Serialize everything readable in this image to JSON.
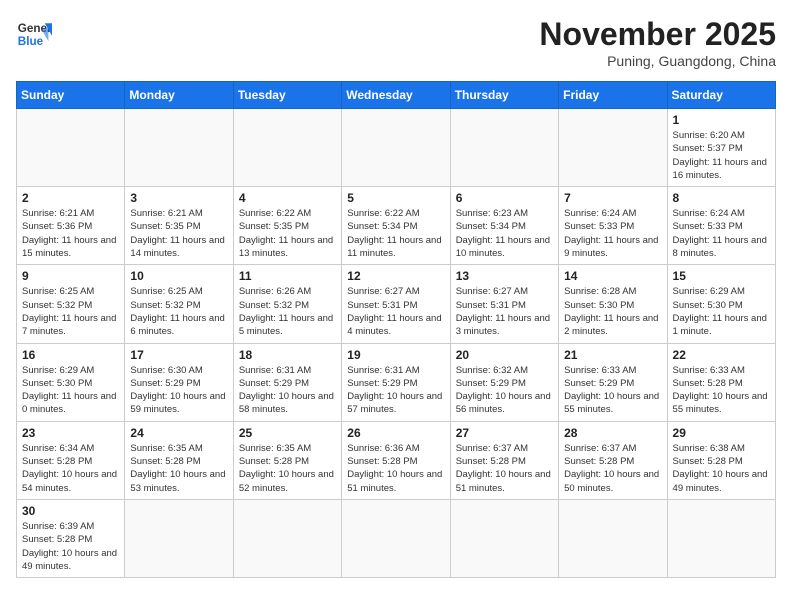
{
  "logo": {
    "line1": "General",
    "line2": "Blue"
  },
  "title": "November 2025",
  "subtitle": "Puning, Guangdong, China",
  "weekdays": [
    "Sunday",
    "Monday",
    "Tuesday",
    "Wednesday",
    "Thursday",
    "Friday",
    "Saturday"
  ],
  "weeks": [
    [
      {
        "day": "",
        "info": ""
      },
      {
        "day": "",
        "info": ""
      },
      {
        "day": "",
        "info": ""
      },
      {
        "day": "",
        "info": ""
      },
      {
        "day": "",
        "info": ""
      },
      {
        "day": "",
        "info": ""
      },
      {
        "day": "1",
        "info": "Sunrise: 6:20 AM\nSunset: 5:37 PM\nDaylight: 11 hours and 16 minutes."
      }
    ],
    [
      {
        "day": "2",
        "info": "Sunrise: 6:21 AM\nSunset: 5:36 PM\nDaylight: 11 hours and 15 minutes."
      },
      {
        "day": "3",
        "info": "Sunrise: 6:21 AM\nSunset: 5:35 PM\nDaylight: 11 hours and 14 minutes."
      },
      {
        "day": "4",
        "info": "Sunrise: 6:22 AM\nSunset: 5:35 PM\nDaylight: 11 hours and 13 minutes."
      },
      {
        "day": "5",
        "info": "Sunrise: 6:22 AM\nSunset: 5:34 PM\nDaylight: 11 hours and 11 minutes."
      },
      {
        "day": "6",
        "info": "Sunrise: 6:23 AM\nSunset: 5:34 PM\nDaylight: 11 hours and 10 minutes."
      },
      {
        "day": "7",
        "info": "Sunrise: 6:24 AM\nSunset: 5:33 PM\nDaylight: 11 hours and 9 minutes."
      },
      {
        "day": "8",
        "info": "Sunrise: 6:24 AM\nSunset: 5:33 PM\nDaylight: 11 hours and 8 minutes."
      }
    ],
    [
      {
        "day": "9",
        "info": "Sunrise: 6:25 AM\nSunset: 5:32 PM\nDaylight: 11 hours and 7 minutes."
      },
      {
        "day": "10",
        "info": "Sunrise: 6:25 AM\nSunset: 5:32 PM\nDaylight: 11 hours and 6 minutes."
      },
      {
        "day": "11",
        "info": "Sunrise: 6:26 AM\nSunset: 5:32 PM\nDaylight: 11 hours and 5 minutes."
      },
      {
        "day": "12",
        "info": "Sunrise: 6:27 AM\nSunset: 5:31 PM\nDaylight: 11 hours and 4 minutes."
      },
      {
        "day": "13",
        "info": "Sunrise: 6:27 AM\nSunset: 5:31 PM\nDaylight: 11 hours and 3 minutes."
      },
      {
        "day": "14",
        "info": "Sunrise: 6:28 AM\nSunset: 5:30 PM\nDaylight: 11 hours and 2 minutes."
      },
      {
        "day": "15",
        "info": "Sunrise: 6:29 AM\nSunset: 5:30 PM\nDaylight: 11 hours and 1 minute."
      }
    ],
    [
      {
        "day": "16",
        "info": "Sunrise: 6:29 AM\nSunset: 5:30 PM\nDaylight: 11 hours and 0 minutes."
      },
      {
        "day": "17",
        "info": "Sunrise: 6:30 AM\nSunset: 5:29 PM\nDaylight: 10 hours and 59 minutes."
      },
      {
        "day": "18",
        "info": "Sunrise: 6:31 AM\nSunset: 5:29 PM\nDaylight: 10 hours and 58 minutes."
      },
      {
        "day": "19",
        "info": "Sunrise: 6:31 AM\nSunset: 5:29 PM\nDaylight: 10 hours and 57 minutes."
      },
      {
        "day": "20",
        "info": "Sunrise: 6:32 AM\nSunset: 5:29 PM\nDaylight: 10 hours and 56 minutes."
      },
      {
        "day": "21",
        "info": "Sunrise: 6:33 AM\nSunset: 5:29 PM\nDaylight: 10 hours and 55 minutes."
      },
      {
        "day": "22",
        "info": "Sunrise: 6:33 AM\nSunset: 5:28 PM\nDaylight: 10 hours and 55 minutes."
      }
    ],
    [
      {
        "day": "23",
        "info": "Sunrise: 6:34 AM\nSunset: 5:28 PM\nDaylight: 10 hours and 54 minutes."
      },
      {
        "day": "24",
        "info": "Sunrise: 6:35 AM\nSunset: 5:28 PM\nDaylight: 10 hours and 53 minutes."
      },
      {
        "day": "25",
        "info": "Sunrise: 6:35 AM\nSunset: 5:28 PM\nDaylight: 10 hours and 52 minutes."
      },
      {
        "day": "26",
        "info": "Sunrise: 6:36 AM\nSunset: 5:28 PM\nDaylight: 10 hours and 51 minutes."
      },
      {
        "day": "27",
        "info": "Sunrise: 6:37 AM\nSunset: 5:28 PM\nDaylight: 10 hours and 51 minutes."
      },
      {
        "day": "28",
        "info": "Sunrise: 6:37 AM\nSunset: 5:28 PM\nDaylight: 10 hours and 50 minutes."
      },
      {
        "day": "29",
        "info": "Sunrise: 6:38 AM\nSunset: 5:28 PM\nDaylight: 10 hours and 49 minutes."
      }
    ],
    [
      {
        "day": "30",
        "info": "Sunrise: 6:39 AM\nSunset: 5:28 PM\nDaylight: 10 hours and 49 minutes."
      },
      {
        "day": "",
        "info": ""
      },
      {
        "day": "",
        "info": ""
      },
      {
        "day": "",
        "info": ""
      },
      {
        "day": "",
        "info": ""
      },
      {
        "day": "",
        "info": ""
      },
      {
        "day": "",
        "info": ""
      }
    ]
  ]
}
